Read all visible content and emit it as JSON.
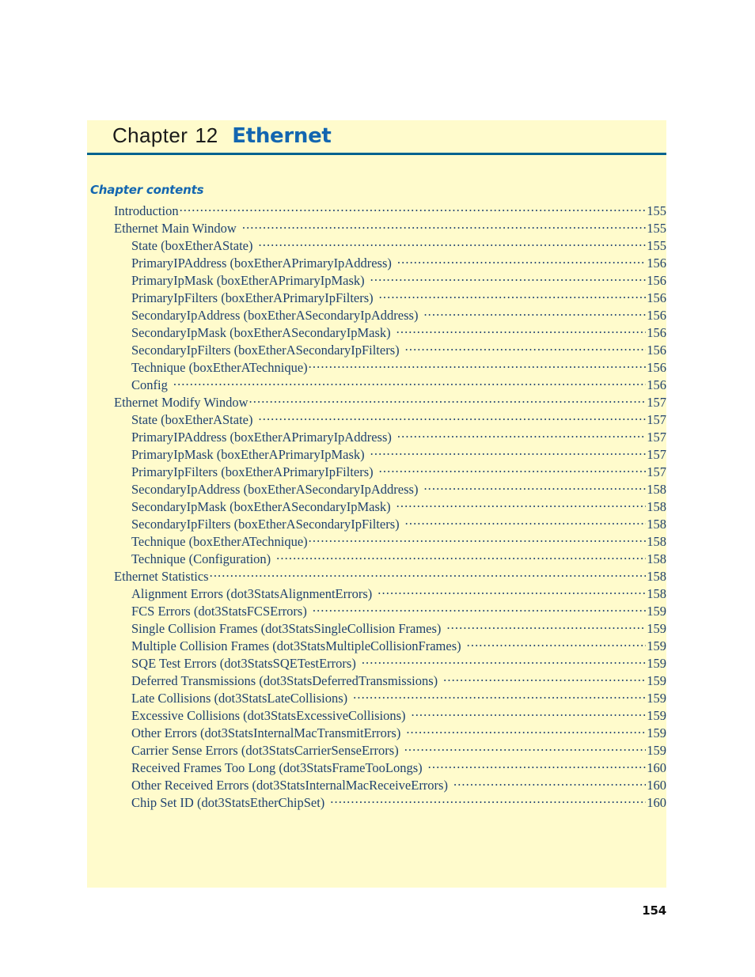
{
  "chapter": {
    "label": "Chapter",
    "number": "12",
    "name": "Ethernet",
    "contents_heading": "Chapter contents"
  },
  "colors": {
    "block_background": "#fffbcc",
    "rule": "#00628f",
    "chapter_name": "#1366b0",
    "heading": "#1366b0",
    "toc_text": "#1f4170",
    "page_background": "#ffffff",
    "folio": "#111111"
  },
  "toc": [
    {
      "level": 1,
      "label": "Introduction",
      "page": "155",
      "gap": false
    },
    {
      "level": 1,
      "label": "Ethernet Main Window",
      "page": "155",
      "gap": true
    },
    {
      "level": 2,
      "label": "State (boxEtherAState)",
      "page": "155",
      "gap": true
    },
    {
      "level": 2,
      "label": "PrimaryIPAddress (boxEtherAPrimaryIpAddress)",
      "page": "156",
      "gap": true
    },
    {
      "level": 2,
      "label": "PrimaryIpMask (boxEtherAPrimaryIpMask)",
      "page": "156",
      "gap": true
    },
    {
      "level": 2,
      "label": "PrimaryIpFilters (boxEtherAPrimaryIpFilters)",
      "page": "156",
      "gap": true
    },
    {
      "level": 2,
      "label": "SecondaryIpAddress (boxEtherASecondaryIpAddress)",
      "page": "156",
      "gap": true
    },
    {
      "level": 2,
      "label": "SecondaryIpMask (boxEtherASecondaryIpMask)",
      "page": "156",
      "gap": true
    },
    {
      "level": 2,
      "label": "SecondaryIpFilters (boxEtherASecondaryIpFilters)",
      "page": "156",
      "gap": true
    },
    {
      "level": 2,
      "label": "Technique (boxEtherATechnique)",
      "page": "156",
      "gap": false
    },
    {
      "level": 2,
      "label": "Config",
      "page": "156",
      "gap": true
    },
    {
      "level": 1,
      "label": "Ethernet Modify Window",
      "page": "157",
      "gap": false
    },
    {
      "level": 2,
      "label": "State (boxEtherAState)",
      "page": "157",
      "gap": true
    },
    {
      "level": 2,
      "label": "PrimaryIPAddress (boxEtherAPrimaryIpAddress)",
      "page": "157",
      "gap": true
    },
    {
      "level": 2,
      "label": "PrimaryIpMask (boxEtherAPrimaryIpMask)",
      "page": "157",
      "gap": true
    },
    {
      "level": 2,
      "label": "PrimaryIpFilters (boxEtherAPrimaryIpFilters)",
      "page": "157",
      "gap": true
    },
    {
      "level": 2,
      "label": "SecondaryIpAddress (boxEtherASecondaryIpAddress)",
      "page": "158",
      "gap": true
    },
    {
      "level": 2,
      "label": "SecondaryIpMask (boxEtherASecondaryIpMask)",
      "page": "158",
      "gap": true
    },
    {
      "level": 2,
      "label": "SecondaryIpFilters (boxEtherASecondaryIpFilters)",
      "page": "158",
      "gap": true
    },
    {
      "level": 2,
      "label": "Technique (boxEtherATechnique)",
      "page": "158",
      "gap": false
    },
    {
      "level": 2,
      "label": "Technique (Configuration)",
      "page": "158",
      "gap": true
    },
    {
      "level": 1,
      "label": "Ethernet Statistics",
      "page": "158",
      "gap": false
    },
    {
      "level": 2,
      "label": "Alignment Errors (dot3StatsAlignmentErrors)",
      "page": "158",
      "gap": true
    },
    {
      "level": 2,
      "label": "FCS Errors (dot3StatsFCSErrors)",
      "page": "159",
      "gap": true
    },
    {
      "level": 2,
      "label": "Single Collision Frames (dot3StatsSingleCollision Frames)",
      "page": "159",
      "gap": true
    },
    {
      "level": 2,
      "label": "Multiple Collision Frames (dot3StatsMultipleCollisionFrames)",
      "page": "159",
      "gap": true
    },
    {
      "level": 2,
      "label": "SQE Test Errors (dot3StatsSQETestErrors)",
      "page": "159",
      "gap": true
    },
    {
      "level": 2,
      "label": "Deferred Transmissions (dot3StatsDeferredTransmissions)",
      "page": "159",
      "gap": true
    },
    {
      "level": 2,
      "label": "Late Collisions (dot3StatsLateCollisions)",
      "page": "159",
      "gap": true
    },
    {
      "level": 2,
      "label": "Excessive Collisions (dot3StatsExcessiveCollisions)",
      "page": "159",
      "gap": true
    },
    {
      "level": 2,
      "label": "Other Errors (dot3StatsInternalMacTransmitErrors)",
      "page": "159",
      "gap": true
    },
    {
      "level": 2,
      "label": "Carrier Sense Errors (dot3StatsCarrierSenseErrors)",
      "page": "159",
      "gap": true
    },
    {
      "level": 2,
      "label": "Received Frames Too Long (dot3StatsFrameTooLongs)",
      "page": "160",
      "gap": true
    },
    {
      "level": 2,
      "label": "Other Received Errors (dot3StatsInternalMacReceiveErrors)",
      "page": "160",
      "gap": true
    },
    {
      "level": 2,
      "label": "Chip Set ID (dot3StatsEtherChipSet)",
      "page": "160",
      "gap": true
    }
  ],
  "footer": {
    "page_number": "154"
  }
}
